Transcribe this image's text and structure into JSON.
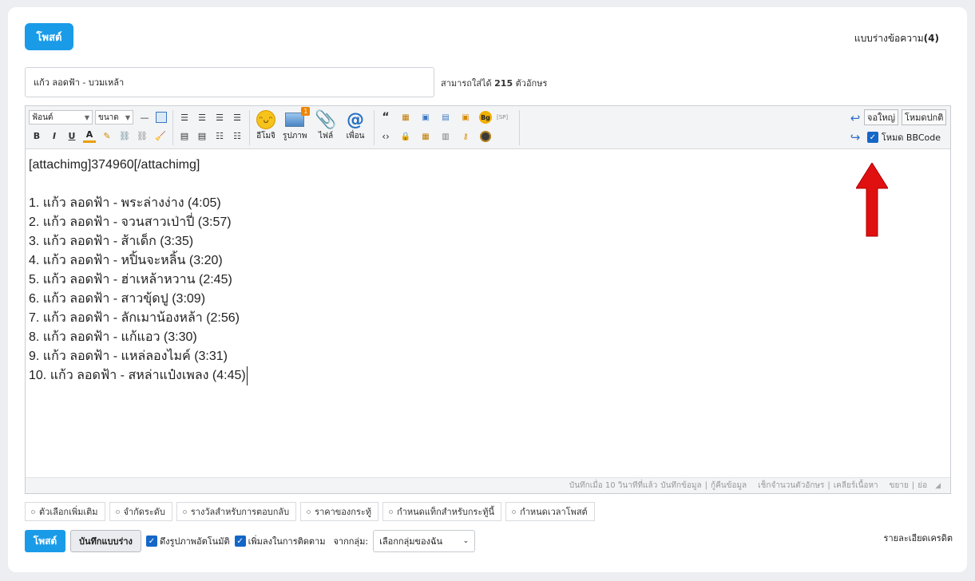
{
  "header": {
    "post_label": "โพสต์",
    "drafts_label": "แบบร่างข้อความ",
    "drafts_count": "(4)"
  },
  "title": {
    "value": "แก้ว ลอดฟ้า - บวมเหล้า",
    "hint_prefix": "สามารถใส่ได้",
    "hint_count": "215",
    "hint_suffix": "ตัวอักษร"
  },
  "toolbar": {
    "font_select": "ฟ้อนต์",
    "size_select": "ขนาด",
    "emoji_label": "อีโมจิ",
    "image_label": "รูปภาพ",
    "image_badge": "1",
    "file_label": "ไฟล์",
    "friend_label": "เพื่อน",
    "sp_label": "[SP]",
    "bg_label": "Bg",
    "fullscreen_label": "จอใหญ่",
    "normal_mode_label": "โหมดปกติ",
    "bbcode_label": "โหมด BBCode",
    "bold": "B",
    "italic": "I",
    "underline": "U",
    "color": "A"
  },
  "editor": {
    "lines": [
      "[attachimg]374960[/attachimg]",
      "",
      "1. แก้ว ลอดฟ้า - พระล่างง่าง (4:05)",
      "2. แก้ว ลอดฟ้า - จวนสาวเป่าปี่ (3:57)",
      "3. แก้ว ลอดฟ้า - ส้าเด็ก (3:35)",
      "4. แก้ว ลอดฟ้า - หปิ้นจะหลิ้น (3:20)",
      "5. แก้ว ลอดฟ้า - ฮ่าเหล้าหวาน (2:45)",
      "6. แก้ว ลอดฟ้า - สาวขุ้ดปู (3:09)",
      "7. แก้ว ลอดฟ้า - ลักเมาน้องหล้า (2:56)",
      "8. แก้ว ลอดฟ้า - แก้แอว (3:30)",
      "9. แก้ว ลอดฟ้า - แหล่ลองไมค์ (3:31)",
      "10. แก้ว ลอดฟ้า - สหล่าแป๋งเพลง (4:45)"
    ],
    "status_saved": "บันทึกเมื่อ 10 วินาทีที่แล้ว",
    "status_save_data": "บันทึกข้อมูล",
    "status_restore": "กู้คืนข้อมูล",
    "status_count": "เช็กจำนวนตัวอักษร",
    "status_clear": "เคลียร์เนื้อหา",
    "status_expand": "ขยาย",
    "status_shrink": "ย่อ"
  },
  "options": [
    "ตัวเลือกเพิ่มเติม",
    "จำกัดระดับ",
    "รางวัลสำหรับการตอบกลับ",
    "ราคาของกระทู้",
    "กำหนดแท็กสำหรับกระทู้นี้",
    "กำหนดเวลาโพสต์"
  ],
  "bottom": {
    "post_label": "โพสต์",
    "save_draft_label": "บันทึกแบบร่าง",
    "auto_image_label": "ดึงรูปภาพอัตโนมัติ",
    "follow_label": "เพิ่มลงในการติดตาม",
    "from_group_label": "จากกลุ่ม:",
    "group_select": "เลือกกลุ่มของฉัน",
    "credit_label": "รายละเอียดเครดิต"
  },
  "colors": {
    "accent": "#1a9be8",
    "checkbox": "#1467c7",
    "arrow": "#e01010"
  }
}
